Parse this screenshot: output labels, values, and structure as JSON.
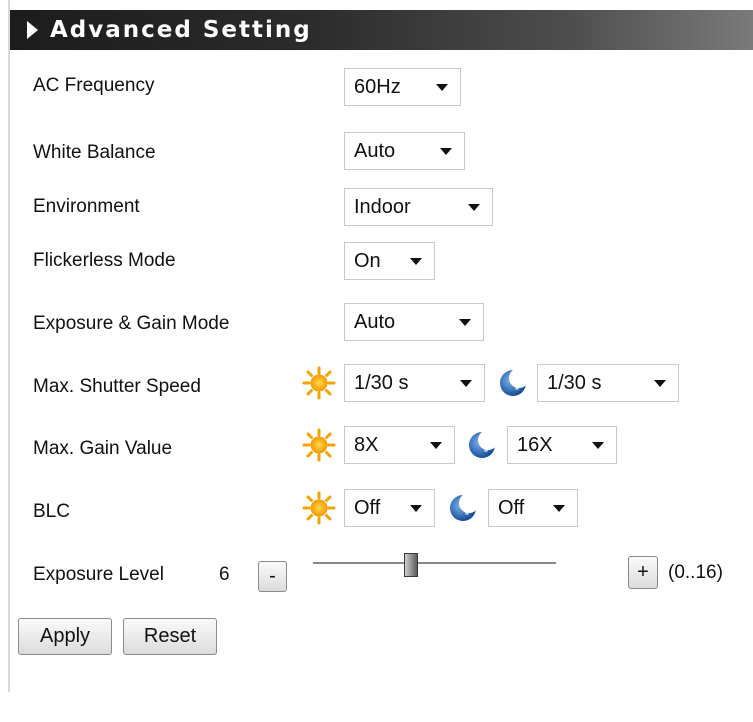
{
  "header": {
    "title": "Advanced Setting"
  },
  "rows": {
    "ac_frequency": {
      "label": "AC Frequency",
      "value": "60Hz"
    },
    "white_balance": {
      "label": "White Balance",
      "value": "Auto"
    },
    "environment": {
      "label": "Environment",
      "value": "Indoor"
    },
    "flickerless_mode": {
      "label": "Flickerless Mode",
      "value": "On"
    },
    "exposure_gain_mode": {
      "label": "Exposure & Gain Mode",
      "value": "Auto"
    },
    "max_shutter_speed": {
      "label": "Max. Shutter Speed",
      "day_value": "1/30 s",
      "night_value": "1/30 s"
    },
    "max_gain_value": {
      "label": "Max. Gain Value",
      "day_value": "8X",
      "night_value": "16X"
    },
    "blc": {
      "label": "BLC",
      "day_value": "Off",
      "night_value": "Off"
    }
  },
  "exposure_level": {
    "label": "Exposure Level",
    "value": "6",
    "min": 0,
    "max": 16,
    "decrement_label": "-",
    "increment_label": "+",
    "range_text": "(0..16)"
  },
  "buttons": {
    "apply": "Apply",
    "reset": "Reset"
  },
  "icons": {
    "day": "sun-icon",
    "night": "moon-icon"
  },
  "colors": {
    "header_dark": "#1c1c1c",
    "header_light": "#7a7a7a",
    "sun": "#f7a400",
    "moon": "#1f5fae"
  }
}
